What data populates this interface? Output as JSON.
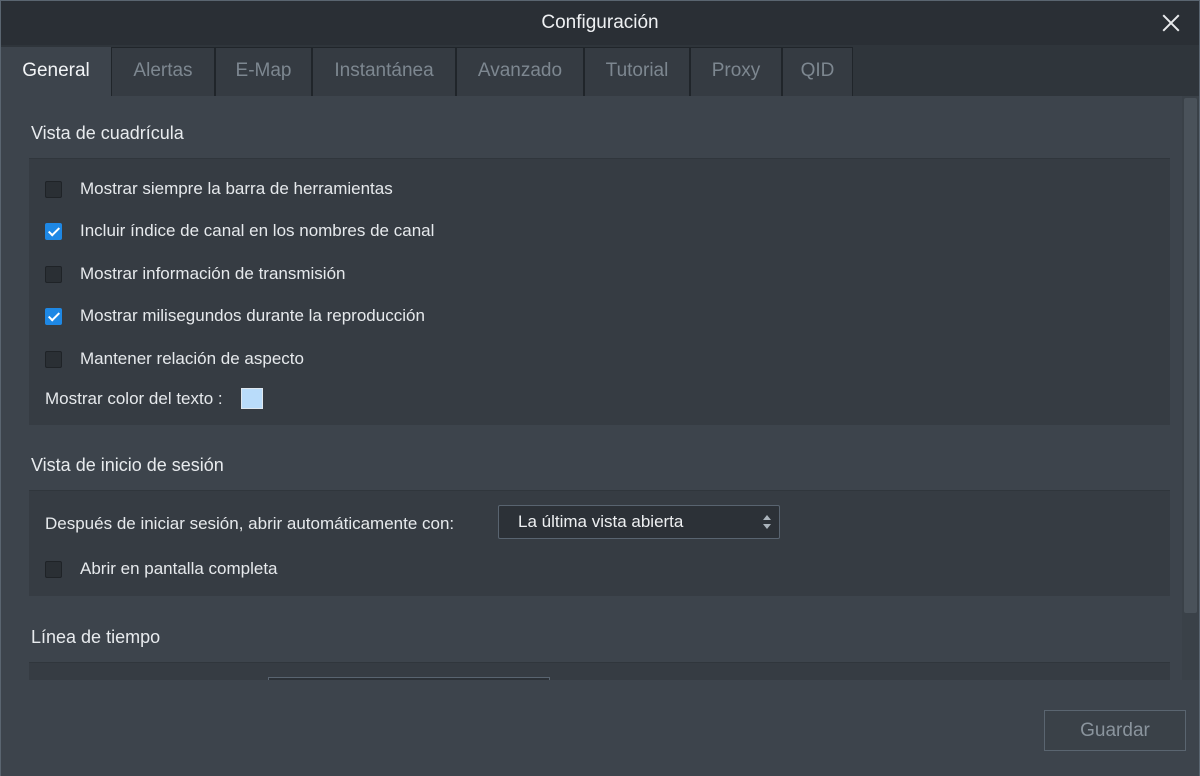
{
  "window": {
    "title": "Configuración"
  },
  "tabs": [
    {
      "label": "General",
      "active": true
    },
    {
      "label": "Alertas",
      "active": false
    },
    {
      "label": "E-Map",
      "active": false
    },
    {
      "label": "Instantánea",
      "active": false
    },
    {
      "label": "Avanzado",
      "active": false
    },
    {
      "label": "Tutorial",
      "active": false
    },
    {
      "label": "Proxy",
      "active": false
    },
    {
      "label": "QID",
      "active": false
    }
  ],
  "grid_view": {
    "title": "Vista de cuadrícula",
    "options": [
      {
        "label": "Mostrar siempre la barra de herramientas",
        "checked": false
      },
      {
        "label": "Incluir índice de canal en los nombres de canal",
        "checked": true
      },
      {
        "label": "Mostrar información de transmisión",
        "checked": false
      },
      {
        "label": "Mostrar milisegundos durante la reproducción",
        "checked": true
      },
      {
        "label": "Mantener relación de aspecto",
        "checked": false
      }
    ],
    "text_color_label": "Mostrar color del texto :",
    "text_color_value": "#b9dcfa"
  },
  "login_view": {
    "title": "Vista de inicio de sesión",
    "auto_open_label": "Después de iniciar sesión, abrir automáticamente con:",
    "auto_open_value": "La última vista abierta",
    "fullscreen": {
      "label": "Abrir en pantalla completa",
      "checked": false
    }
  },
  "timeline": {
    "title": "Línea de tiempo"
  },
  "footer": {
    "save_label": "Guardar"
  },
  "watermark": "review",
  "colors": {
    "accent": "#1e88e5",
    "background": "#3d444c",
    "titlebar": "#2a2f35"
  }
}
